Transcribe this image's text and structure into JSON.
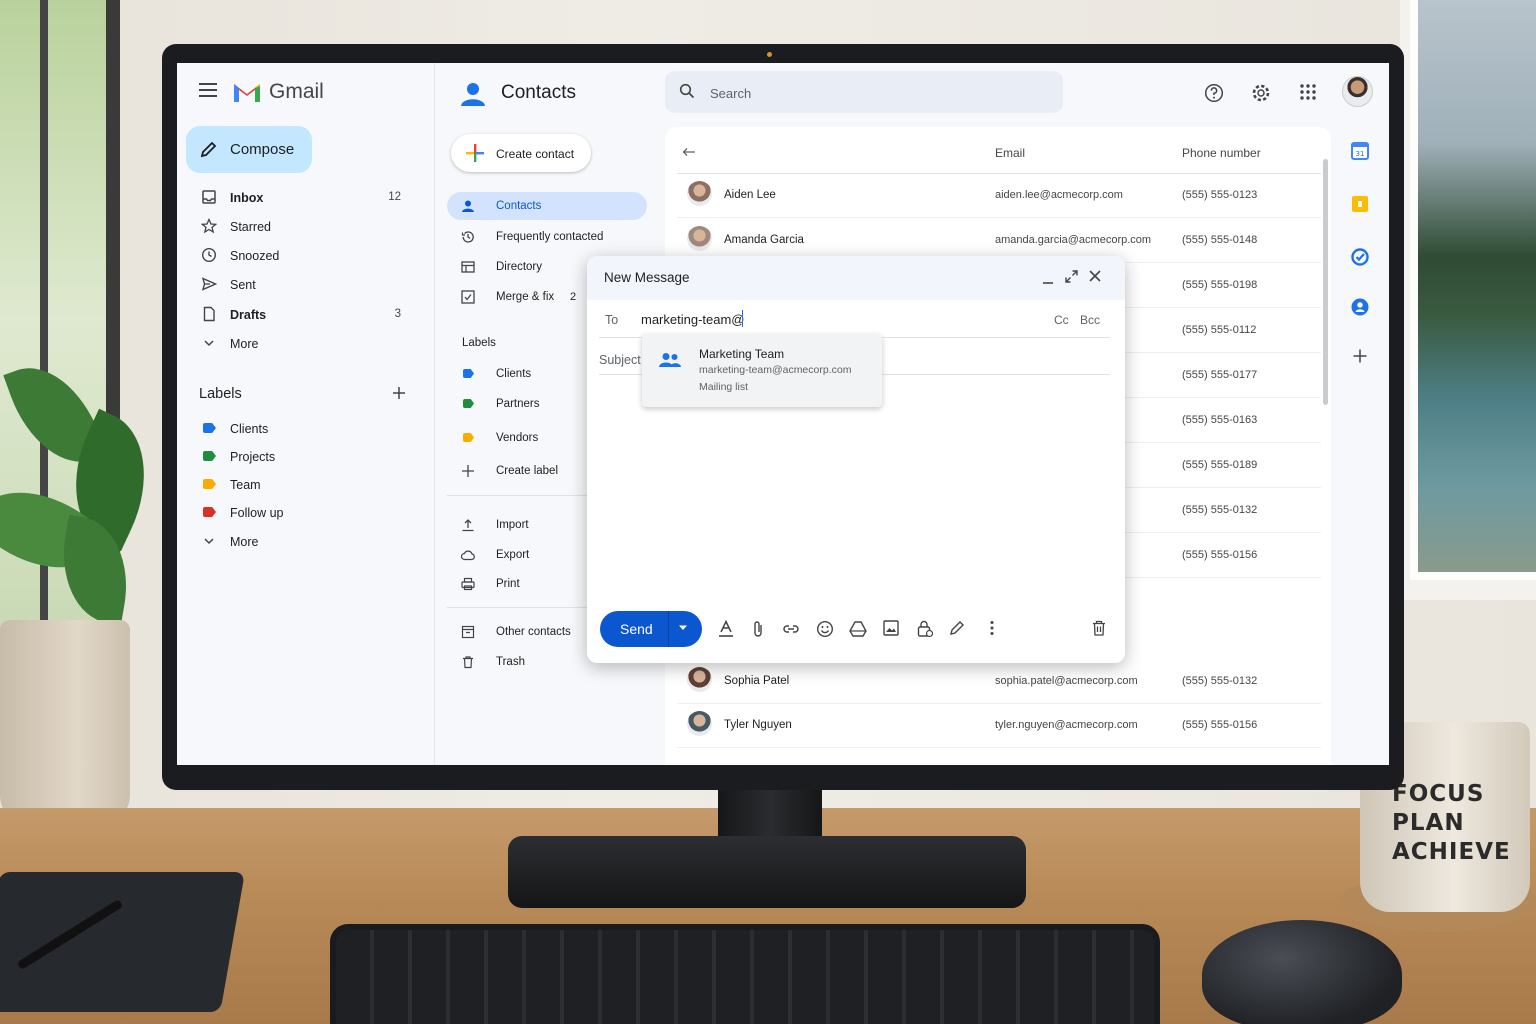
{
  "gmail": {
    "title": "Gmail",
    "compose_label": "Compose",
    "nav": [
      {
        "label": "Inbox",
        "count": "12",
        "icon": "inbox-icon",
        "bold": true
      },
      {
        "label": "Starred",
        "count": "",
        "icon": "star-icon"
      },
      {
        "label": "Snoozed",
        "count": "",
        "icon": "clock-icon"
      },
      {
        "label": "Sent",
        "count": "",
        "icon": "send-icon"
      },
      {
        "label": "Drafts",
        "count": "3",
        "icon": "draft-icon",
        "bold": true
      },
      {
        "label": "More",
        "count": "",
        "icon": "chevron-down-icon"
      }
    ],
    "labels_heading": "Labels",
    "labels": [
      {
        "label": "Clients",
        "color": "#1a73e8"
      },
      {
        "label": "Projects",
        "color": "#1e8e3e"
      },
      {
        "label": "Team",
        "color": "#f9ab00"
      },
      {
        "label": "Follow up",
        "color": "#d93025"
      }
    ],
    "labels_more": "More"
  },
  "contacts": {
    "title": "Contacts",
    "create_label": "Create contact",
    "nav": [
      {
        "label": "Contacts",
        "active": true,
        "icon": "person-icon"
      },
      {
        "label": "Frequently contacted",
        "icon": "history-icon"
      },
      {
        "label": "Directory",
        "icon": "directory-icon"
      },
      {
        "label": "Merge & fix",
        "count": "2",
        "icon": "merge-icon"
      }
    ],
    "labels_heading": "Labels",
    "labels": [
      {
        "label": "Clients",
        "color": "#1a73e8"
      },
      {
        "label": "Partners",
        "color": "#1e8e3e"
      },
      {
        "label": "Vendors",
        "color": "#f9ab00"
      }
    ],
    "create_label_item": "Create label",
    "tools": [
      "Import",
      "Export",
      "Print"
    ],
    "extra": [
      "Other contacts",
      "Trash"
    ]
  },
  "search": {
    "placeholder": "Search"
  },
  "table": {
    "headers": {
      "email": "Email",
      "phone": "Phone number"
    },
    "rows": [
      {
        "name": "Aiden Lee",
        "email": "aiden.lee@acmecorp.com",
        "phone": "(555) 555-0123"
      },
      {
        "name": "Amanda Garcia",
        "email": "amanda.garcia@acmecorp.com",
        "phone": "(555) 555-0148"
      },
      {
        "name": "",
        "email": "",
        "phone": "(555) 555-0198"
      },
      {
        "name": "",
        "email": "",
        "phone": "(555) 555-0112"
      },
      {
        "name": "",
        "email": "",
        "phone": "(555) 555-0177"
      },
      {
        "name": "",
        "email": "",
        "phone": "(555) 555-0163"
      },
      {
        "name": "",
        "email": "",
        "phone": "(555) 555-0189"
      },
      {
        "name": "",
        "email": "",
        "phone": "(555) 555-0132"
      },
      {
        "name": "",
        "email": "",
        "phone": "(555) 555-0156"
      },
      {
        "name": "",
        "email": "",
        "phone": ""
      },
      {
        "name": "Sophia Patel",
        "email": "sophia.patel@acmecorp.com",
        "phone": "(555) 555-0132"
      },
      {
        "name": "Tyler Nguyen",
        "email": "tyler.nguyen@acmecorp.com",
        "phone": "(555) 555-0156"
      }
    ]
  },
  "compose": {
    "title": "New Message",
    "to_label": "To",
    "to_value": "marketing-team@",
    "cc_label": "Cc",
    "bcc_label": "Bcc",
    "subject_label": "Subject",
    "send_label": "Send",
    "suggestion": {
      "name": "Marketing Team",
      "email": "marketing-team@acmecorp.com",
      "type": "Mailing list"
    }
  },
  "mug": {
    "text": [
      "FOCUS",
      "PLAN",
      "ACHIEVE"
    ]
  },
  "colors": {
    "accent": "#0b57d0",
    "active_nav": "#d3e3fd",
    "compose_bg": "#c2e7ff"
  }
}
